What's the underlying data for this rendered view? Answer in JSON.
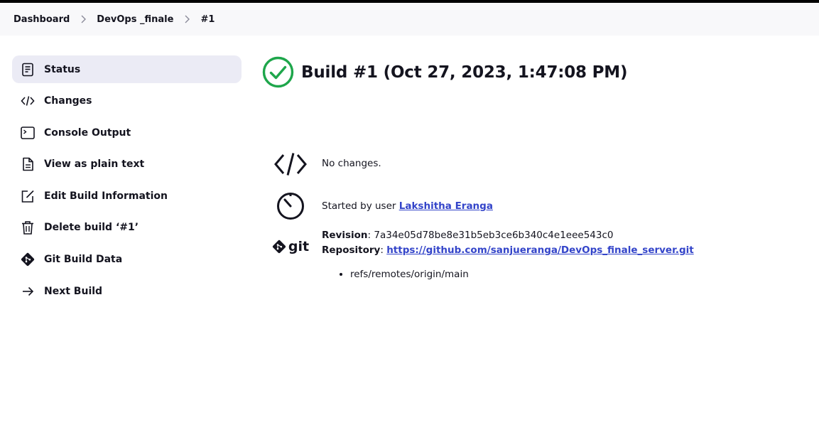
{
  "breadcrumbs": [
    {
      "label": "Dashboard"
    },
    {
      "label": "DevOps _finale"
    },
    {
      "label": "#1"
    }
  ],
  "sidebar": {
    "items": [
      {
        "label": "Status",
        "icon": "document-icon",
        "active": true
      },
      {
        "label": "Changes",
        "icon": "code-icon"
      },
      {
        "label": "Console Output",
        "icon": "terminal-icon"
      },
      {
        "label": "View as plain text",
        "icon": "file-text-icon"
      },
      {
        "label": "Edit Build Information",
        "icon": "edit-icon"
      },
      {
        "label": "Delete build ‘#1’",
        "icon": "trash-icon"
      },
      {
        "label": "Git Build Data",
        "icon": "git-icon"
      },
      {
        "label": "Next Build",
        "icon": "arrow-right-icon"
      }
    ]
  },
  "main": {
    "title": "Build #1 (Oct 27, 2023, 1:47:08 PM)",
    "status_color": "#1ea64b",
    "changes_text": "No changes.",
    "started_by_prefix": "Started by user ",
    "started_by_user": "Lakshitha Eranga",
    "git_label": "git",
    "revision_label": "Revision",
    "revision_value": "7a34e05d78be8e31b5eb3ce6b340c4e1eee543c0",
    "repository_label": "Repository",
    "repository_value": "https://github.com/sanjueranga/DevOps_finale_server.git",
    "branches": [
      "refs/remotes/origin/main"
    ]
  },
  "colors": {
    "link": "#3344c9",
    "active_bg": "#ebebf5",
    "breadcrumb_bg": "#f8f8fa"
  }
}
